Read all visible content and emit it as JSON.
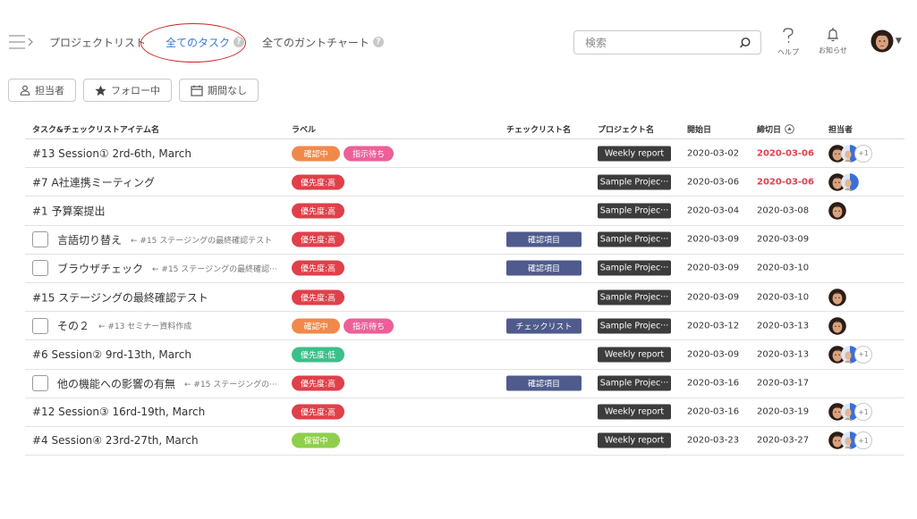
{
  "nav": {
    "project_list": "プロジェクトリスト",
    "all_tasks": "全てのタスク",
    "all_gantt": "全てのガントチャート"
  },
  "search": {
    "placeholder": "検索"
  },
  "header_icons": {
    "help_label": "ヘルプ",
    "notify_label": "お知らせ"
  },
  "filters": {
    "assignee": "担当者",
    "follow": "フォロー中",
    "period": "期間なし"
  },
  "columns": {
    "name": "タスク&チェックリストアイテム名",
    "label": "ラベル",
    "checklist": "チェックリスト名",
    "project": "プロジェクト名",
    "start": "開始日",
    "due": "締切日",
    "assignee": "担当者"
  },
  "colors": {
    "active_nav": "#3a7bd5",
    "label_confirming": "#f08a4b",
    "label_waiting": "#ee5f9a",
    "label_priority_high": "#e0404a",
    "label_priority_low": "#3cbf8a",
    "label_on_hold": "#8fcf4a",
    "checklist_tag": "#4f5b8c",
    "project_tag": "#3c3c3c",
    "overdue_date": "#e0404a"
  },
  "rows": [
    {
      "name": "#13 Session① 2rd-6th, March",
      "is_check": false,
      "parent": "",
      "labels": [
        {
          "text": "確認中",
          "color": "#f08a4b"
        },
        {
          "text": "指示待ち",
          "color": "#ee5f9a"
        }
      ],
      "checklist": "",
      "project": "Weekly report",
      "start": "2020-03-02",
      "due": "2020-03-06",
      "overdue": true,
      "assignees": 2,
      "plus": "+1"
    },
    {
      "name": "#7 A社連携ミーティング",
      "is_check": false,
      "parent": "",
      "labels": [
        {
          "text": "優先度:高",
          "color": "#e0404a"
        }
      ],
      "checklist": "",
      "project": "Sample Projec···",
      "start": "2020-03-06",
      "due": "2020-03-06",
      "overdue": true,
      "assignees": 2,
      "plus": ""
    },
    {
      "name": "#1 予算案提出",
      "is_check": false,
      "parent": "",
      "labels": [
        {
          "text": "優先度:高",
          "color": "#e0404a"
        }
      ],
      "checklist": "",
      "project": "Sample Projec···",
      "start": "2020-03-04",
      "due": "2020-03-08",
      "overdue": false,
      "assignees": 1,
      "plus": ""
    },
    {
      "name": "言語切り替え",
      "is_check": true,
      "parent": "← #15 ステージングの最終確認テスト",
      "labels": [
        {
          "text": "優先度:高",
          "color": "#e0404a"
        }
      ],
      "checklist": "確認項目",
      "project": "Sample Projec···",
      "start": "2020-03-09",
      "due": "2020-03-09",
      "overdue": false,
      "assignees": 0,
      "plus": ""
    },
    {
      "name": "ブラウザチェック",
      "is_check": true,
      "parent": "← #15 ステージングの最終確認···",
      "labels": [
        {
          "text": "優先度:高",
          "color": "#e0404a"
        }
      ],
      "checklist": "確認項目",
      "project": "Sample Projec···",
      "start": "2020-03-09",
      "due": "2020-03-10",
      "overdue": false,
      "assignees": 0,
      "plus": ""
    },
    {
      "name": "#15 ステージングの最終確認テスト",
      "is_check": false,
      "parent": "",
      "labels": [
        {
          "text": "優先度:高",
          "color": "#e0404a"
        }
      ],
      "checklist": "",
      "project": "Sample Projec···",
      "start": "2020-03-09",
      "due": "2020-03-10",
      "overdue": false,
      "assignees": 1,
      "plus": ""
    },
    {
      "name": "その２",
      "is_check": true,
      "parent": "← #13 セミナー資料作成",
      "labels": [
        {
          "text": "確認中",
          "color": "#f08a4b"
        },
        {
          "text": "指示待ち",
          "color": "#ee5f9a"
        }
      ],
      "checklist": "チェックリスト",
      "project": "Sample Projec···",
      "start": "2020-03-12",
      "due": "2020-03-13",
      "overdue": false,
      "assignees": 1,
      "plus": ""
    },
    {
      "name": "#6 Session② 9rd-13th, March",
      "is_check": false,
      "parent": "",
      "labels": [
        {
          "text": "優先度:低",
          "color": "#3cbf8a"
        }
      ],
      "checklist": "",
      "project": "Weekly report",
      "start": "2020-03-09",
      "due": "2020-03-13",
      "overdue": false,
      "assignees": 2,
      "plus": "+1"
    },
    {
      "name": "他の機能への影響の有無",
      "is_check": true,
      "parent": "← #15 ステージングの···",
      "labels": [
        {
          "text": "優先度:高",
          "color": "#e0404a"
        }
      ],
      "checklist": "確認項目",
      "project": "Sample Projec···",
      "start": "2020-03-16",
      "due": "2020-03-17",
      "overdue": false,
      "assignees": 0,
      "plus": ""
    },
    {
      "name": "#12 Session③ 16rd-19th, March",
      "is_check": false,
      "parent": "",
      "labels": [
        {
          "text": "優先度:高",
          "color": "#e0404a"
        }
      ],
      "checklist": "",
      "project": "Weekly report",
      "start": "2020-03-16",
      "due": "2020-03-19",
      "overdue": false,
      "assignees": 2,
      "plus": "+1"
    },
    {
      "name": "#4 Session④ 23rd-27th, March",
      "is_check": false,
      "parent": "",
      "labels": [
        {
          "text": "保留中",
          "color": "#8fcf4a"
        }
      ],
      "checklist": "",
      "project": "Weekly report",
      "start": "2020-03-23",
      "due": "2020-03-27",
      "overdue": false,
      "assignees": 2,
      "plus": "+1"
    }
  ]
}
